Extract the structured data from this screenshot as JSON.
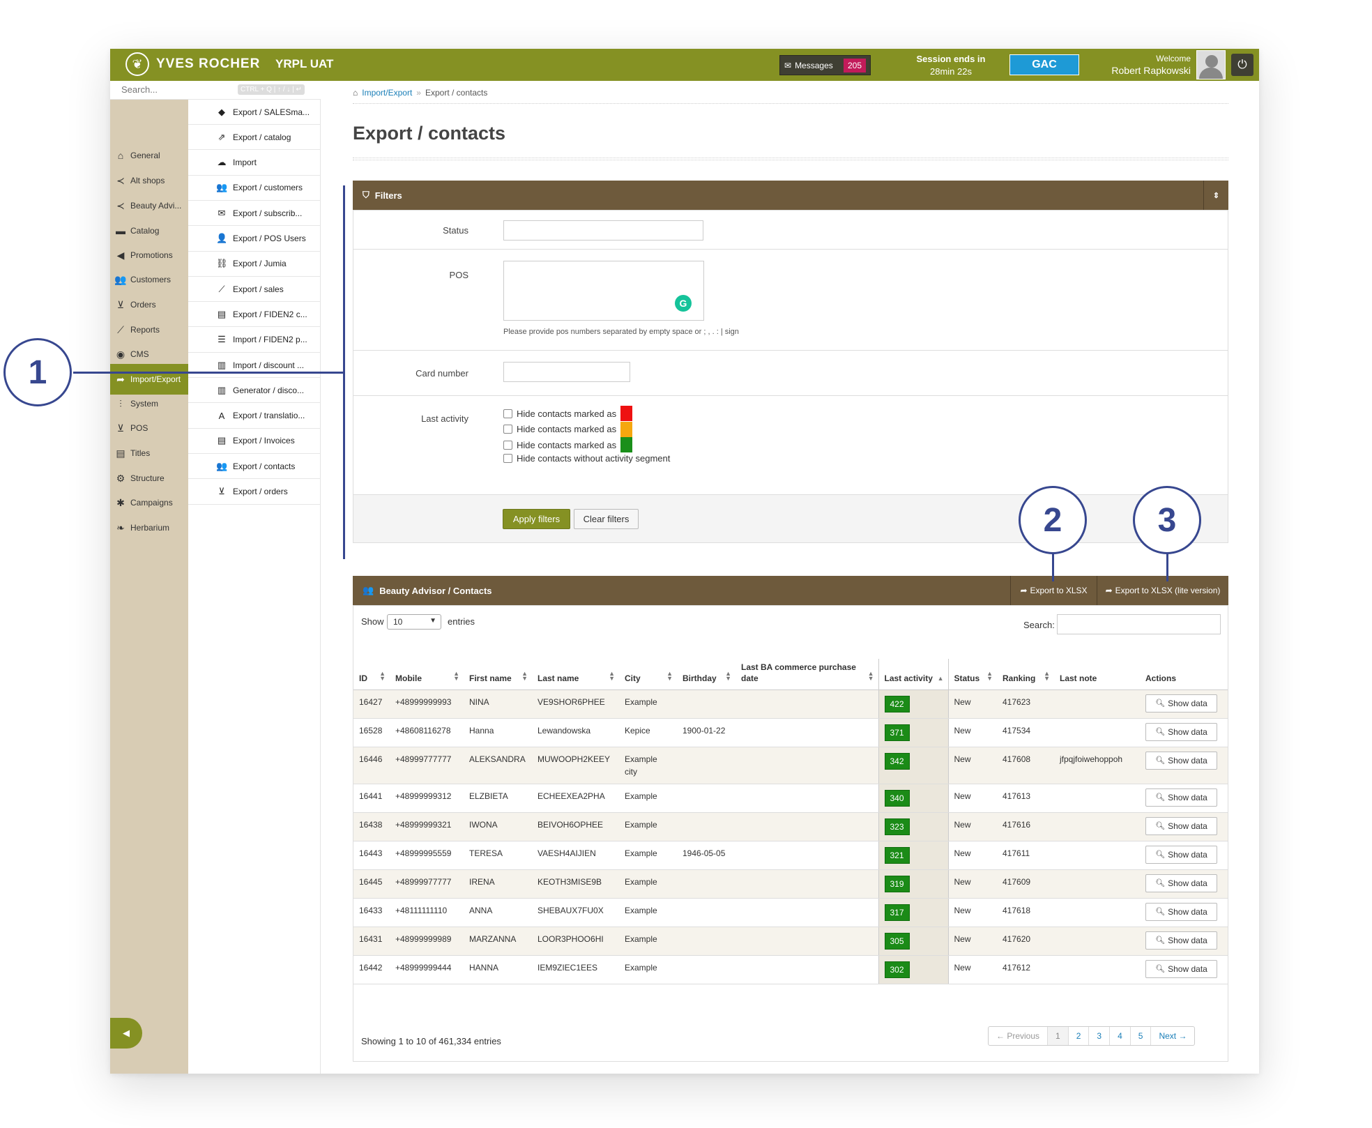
{
  "brand": {
    "name": "YVES ROCHER",
    "env": "YRPL UAT"
  },
  "topbar": {
    "messages_label": "Messages",
    "messages_count": "205",
    "session_line1": "Session ends in",
    "session_line2": "28min 22s",
    "gac_label": "GAC",
    "welcome": "Welcome",
    "user": "Robert Rapkowski"
  },
  "sidebar": {
    "search_placeholder": "Search...",
    "search_shortcut": "CTRL + Q | ↑ / ↓ | ↵",
    "items": [
      {
        "label": "General",
        "icon": "home-icon",
        "glyph": "⌂"
      },
      {
        "label": "Alt shops",
        "icon": "share-icon",
        "glyph": "≺"
      },
      {
        "label": "Beauty Advi...",
        "icon": "share-icon",
        "glyph": "≺"
      },
      {
        "label": "Catalog",
        "icon": "folder-icon",
        "glyph": "▬"
      },
      {
        "label": "Promotions",
        "icon": "megaphone-icon",
        "glyph": "◀"
      },
      {
        "label": "Customers",
        "icon": "users-icon",
        "glyph": "👥"
      },
      {
        "label": "Orders",
        "icon": "cart-icon",
        "glyph": "⊻"
      },
      {
        "label": "Reports",
        "icon": "chart-icon",
        "glyph": "⟋"
      },
      {
        "label": "CMS",
        "icon": "globe-icon",
        "glyph": "◉"
      },
      {
        "label": "Import/Export",
        "icon": "share-arrow-icon",
        "glyph": "➦"
      },
      {
        "label": "System",
        "icon": "sliders-icon",
        "glyph": "⫶"
      },
      {
        "label": "POS",
        "icon": "cart-icon",
        "glyph": "⊻"
      },
      {
        "label": "Titles",
        "icon": "list-alt-icon",
        "glyph": "▤"
      },
      {
        "label": "Structure",
        "icon": "cog-icon",
        "glyph": "⚙"
      },
      {
        "label": "Campaigns",
        "icon": "asterisk-icon",
        "glyph": "✱"
      },
      {
        "label": "Herbarium",
        "icon": "leaf-icon",
        "glyph": "❧"
      }
    ]
  },
  "submenu": {
    "items": [
      {
        "label": "Export / SALESma...",
        "icon": "tag-icon",
        "glyph": "◆"
      },
      {
        "label": "Export / catalog",
        "icon": "external-icon",
        "glyph": "⇗"
      },
      {
        "label": "Import",
        "icon": "cloud-download-icon",
        "glyph": "☁"
      },
      {
        "label": "Export / customers",
        "icon": "users-icon",
        "glyph": "👥"
      },
      {
        "label": "Export / subscrib...",
        "icon": "envelope-icon",
        "glyph": "✉"
      },
      {
        "label": "Export / POS Users",
        "icon": "user-icon",
        "glyph": "👤"
      },
      {
        "label": "Export / Jumia",
        "icon": "link-icon",
        "glyph": "⛓"
      },
      {
        "label": "Export / sales",
        "icon": "chart-icon",
        "glyph": "⟋"
      },
      {
        "label": "Export / FIDEN2 c...",
        "icon": "list-alt-icon",
        "glyph": "▤"
      },
      {
        "label": "Import / FIDEN2 p...",
        "icon": "list-icon",
        "glyph": "☰"
      },
      {
        "label": "Import / discount ...",
        "icon": "barcode-icon",
        "glyph": "▥"
      },
      {
        "label": "Generator / disco...",
        "icon": "barcode-icon",
        "glyph": "▥"
      },
      {
        "label": "Export / translatio...",
        "icon": "font-icon",
        "glyph": "A"
      },
      {
        "label": "Export / Invoices",
        "icon": "list-alt-icon",
        "glyph": "▤"
      },
      {
        "label": "Export / contacts",
        "icon": "users-icon",
        "glyph": "👥"
      },
      {
        "label": "Export / orders",
        "icon": "cart-icon",
        "glyph": "⊻"
      }
    ]
  },
  "breadcrumb": {
    "parent": "Import/Export",
    "sep": "»",
    "current": "Export / contacts"
  },
  "page_title": "Export / contacts",
  "filters": {
    "title": "Filters",
    "status_label": "Status",
    "pos_label": "POS",
    "pos_hint": "Please provide pos numbers separated by empty space or ; , . : | sign",
    "card_label": "Card number",
    "last_activity_label": "Last activity",
    "checkboxes": [
      {
        "label": "Hide contacts marked as",
        "color": "#ee1111"
      },
      {
        "label": "Hide contacts marked as",
        "color": "#f5a70f"
      },
      {
        "label": "Hide contacts marked as",
        "color": "#1a8f1a"
      },
      {
        "label": "Hide contacts without activity segment",
        "color": ""
      }
    ],
    "apply_label": "Apply filters",
    "clear_label": "Clear filters"
  },
  "contacts_panel": {
    "title": "Beauty Advisor / Contacts",
    "export_xlsx": "Export to XLSX",
    "export_xlsx_lite": "Export to XLSX (lite version)",
    "show": "Show",
    "entries_value": "10",
    "entries": "entries",
    "search_label": "Search:"
  },
  "table": {
    "columns": [
      "ID",
      "Mobile",
      "First name",
      "Last name",
      "City",
      "Birthday",
      "Last BA commerce purchase date",
      "Last activity",
      "Status",
      "Ranking",
      "Last note",
      "Actions"
    ],
    "show_data_label": "Show data",
    "rows": [
      {
        "id": "16427",
        "mobile": "+48999999993",
        "first": "NINA",
        "last": "VE9SHOR6PHEE",
        "city": "Example",
        "birthday": "",
        "purchase": "",
        "activity": "422",
        "status": "New",
        "ranking": "417623",
        "note": ""
      },
      {
        "id": "16528",
        "mobile": "+48608116278",
        "first": "Hanna",
        "last": "Lewandowska",
        "city": "Kepice",
        "birthday": "1900-01-22",
        "purchase": "",
        "activity": "371",
        "status": "New",
        "ranking": "417534",
        "note": ""
      },
      {
        "id": "16446",
        "mobile": "+48999777777",
        "first": "ALEKSANDRA",
        "last": "MUWOOPH2KEEY",
        "city": "Example city",
        "birthday": "",
        "purchase": "",
        "activity": "342",
        "status": "New",
        "ranking": "417608",
        "note": "jfpqjfoiwehoppoh"
      },
      {
        "id": "16441",
        "mobile": "+48999999312",
        "first": "ELZBIETA",
        "last": "ECHEEXEA2PHA",
        "city": "Example",
        "birthday": "",
        "purchase": "",
        "activity": "340",
        "status": "New",
        "ranking": "417613",
        "note": ""
      },
      {
        "id": "16438",
        "mobile": "+48999999321",
        "first": "IWONA",
        "last": "BEIVOH6OPHEE",
        "city": "Example",
        "birthday": "",
        "purchase": "",
        "activity": "323",
        "status": "New",
        "ranking": "417616",
        "note": ""
      },
      {
        "id": "16443",
        "mobile": "+48999995559",
        "first": "TERESA",
        "last": "VAESH4AIJIEN",
        "city": "Example",
        "birthday": "1946-05-05",
        "purchase": "",
        "activity": "321",
        "status": "New",
        "ranking": "417611",
        "note": ""
      },
      {
        "id": "16445",
        "mobile": "+48999977777",
        "first": "IRENA",
        "last": "KEOTH3MISE9B",
        "city": "Example",
        "birthday": "",
        "purchase": "",
        "activity": "319",
        "status": "New",
        "ranking": "417609",
        "note": ""
      },
      {
        "id": "16433",
        "mobile": "+48111111110",
        "first": "ANNA",
        "last": "SHEBAUX7FU0X",
        "city": "Example",
        "birthday": "",
        "purchase": "",
        "activity": "317",
        "status": "New",
        "ranking": "417618",
        "note": ""
      },
      {
        "id": "16431",
        "mobile": "+48999999989",
        "first": "MARZANNA",
        "last": "LOOR3PHOO6HI",
        "city": "Example",
        "birthday": "",
        "purchase": "",
        "activity": "305",
        "status": "New",
        "ranking": "417620",
        "note": ""
      },
      {
        "id": "16442",
        "mobile": "+48999999444",
        "first": "HANNA",
        "last": "IEM9ZIEC1EES",
        "city": "Example",
        "birthday": "",
        "purchase": "",
        "activity": "302",
        "status": "New",
        "ranking": "417612",
        "note": ""
      }
    ],
    "info": "Showing 1 to 10 of 461,334 entries",
    "pager": [
      "← Previous",
      "1",
      "2",
      "3",
      "4",
      "5",
      "Next →"
    ]
  },
  "annotations": [
    "1",
    "2",
    "3"
  ],
  "colors": {
    "brand_green": "#859123",
    "panel_brown": "#6e5a3c",
    "annotation": "#37478f"
  }
}
